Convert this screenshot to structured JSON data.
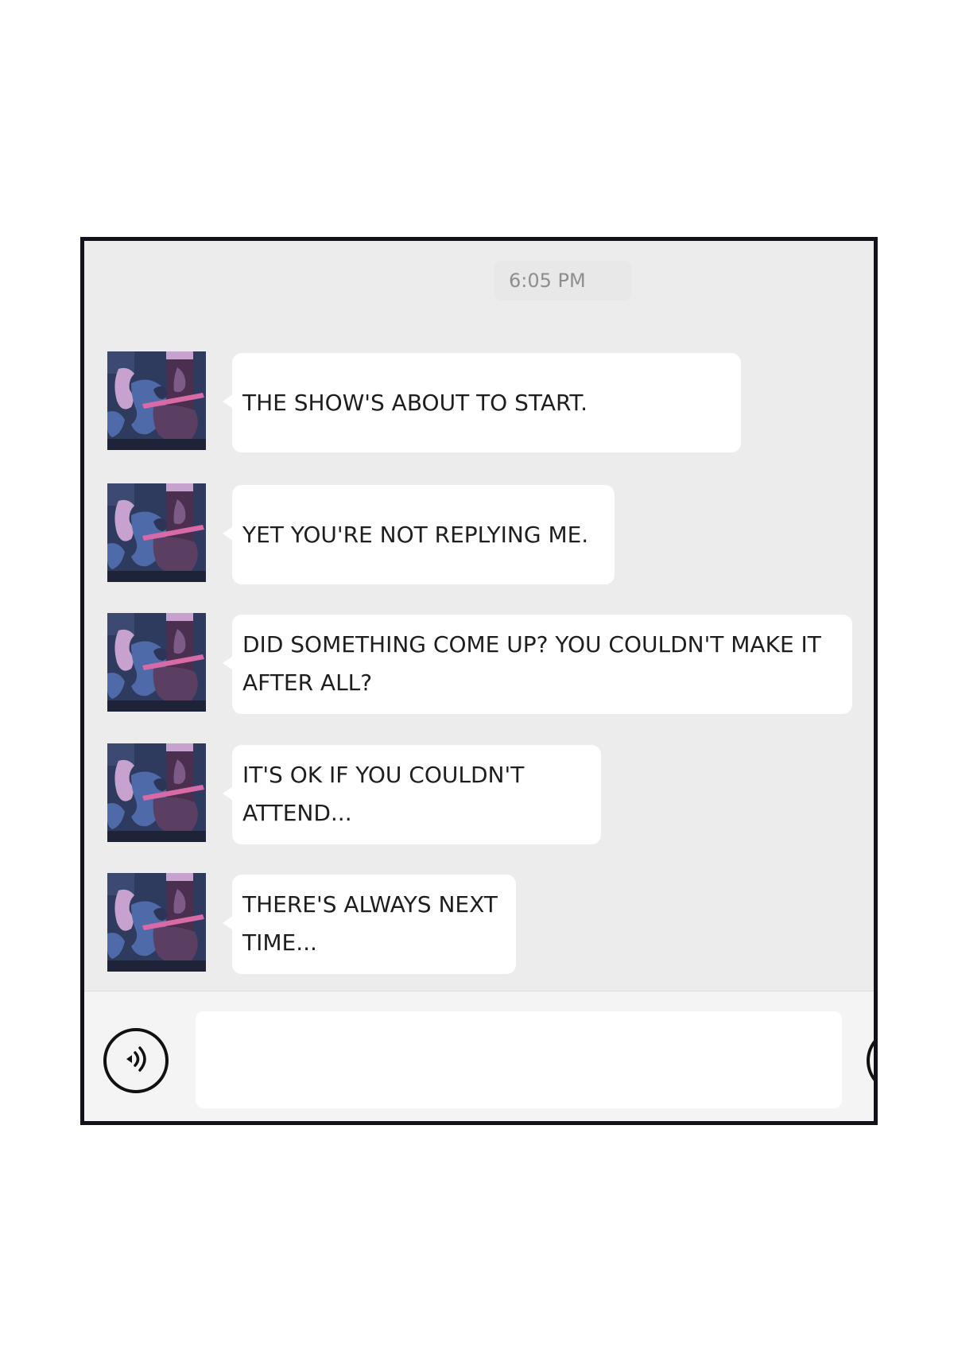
{
  "chat": {
    "timestamp": "6:05 PM",
    "messages": [
      {
        "text": "THE SHOW'S ABOUT TO START."
      },
      {
        "text": "YET YOU'RE NOT REPLYING ME."
      },
      {
        "text": "DID SOMETHING COME UP? YOU COULDN'T MAKE IT\nAFTER ALL?"
      },
      {
        "text": "IT'S OK IF YOU COULDN'T\nATTEND..."
      },
      {
        "text": "THERE'S ALWAYS NEXT\nTIME..."
      }
    ]
  },
  "input_bar": {
    "voice_icon": "voice-icon",
    "message_value": ""
  },
  "colors": {
    "chat_background": "#ececec",
    "bubble": "#ffffff",
    "frame_border": "#11121a",
    "timestamp_text": "#8e8e8e"
  }
}
